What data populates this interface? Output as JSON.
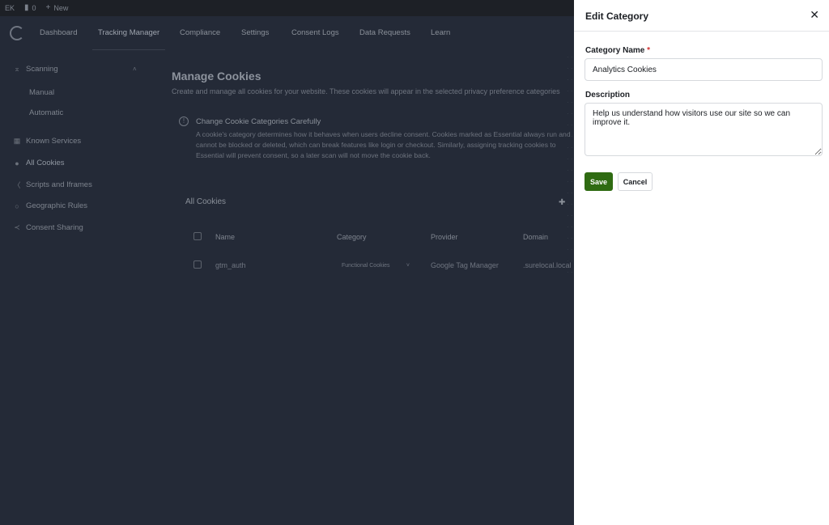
{
  "adminbar": {
    "site": "EK",
    "comments": "0",
    "new": "New"
  },
  "nav": {
    "tabs": [
      "Dashboard",
      "Tracking Manager",
      "Compliance",
      "Settings",
      "Consent Logs",
      "Data Requests",
      "Learn"
    ]
  },
  "sidebar": {
    "scanning": "Scanning",
    "manual": "Manual",
    "automatic": "Automatic",
    "known_services": "Known Services",
    "all_cookies": "All Cookies",
    "scripts": "Scripts and Iframes",
    "geo": "Geographic Rules",
    "consent_sharing": "Consent Sharing"
  },
  "main": {
    "title": "Manage Cookies",
    "subtitle": "Create and manage all cookies for your website. These cookies will appear in the selected privacy preference categories",
    "notice_title": "Change Cookie Categories Carefully",
    "notice_body": "A cookie's category determines how it behaves when users decline consent. Cookies marked as Essential always run and cannot be blocked or deleted, which can break features like login or checkout. Similarly, assigning tracking cookies to Essential will prevent consent, so a later scan will not move the cookie back.",
    "section_title": "All Cookies",
    "columns": [
      "Name",
      "Category",
      "Provider",
      "Domain"
    ],
    "rows": [
      {
        "name": "gtm_auth",
        "category": "Functional Cookies",
        "provider": "Google Tag Manager",
        "domain": ".surelocal.local"
      }
    ]
  },
  "drawer": {
    "title": "Edit Category",
    "name_label": "Category Name",
    "required_mark": "*",
    "name_value": "Analytics Cookies",
    "desc_label": "Description",
    "desc_value": "Help us understand how visitors use our site so we can improve it.",
    "save": "Save",
    "cancel": "Cancel"
  },
  "colors": {
    "accent": "#2f6b12",
    "overlay": "#242a37",
    "required": "#d32f2f"
  }
}
